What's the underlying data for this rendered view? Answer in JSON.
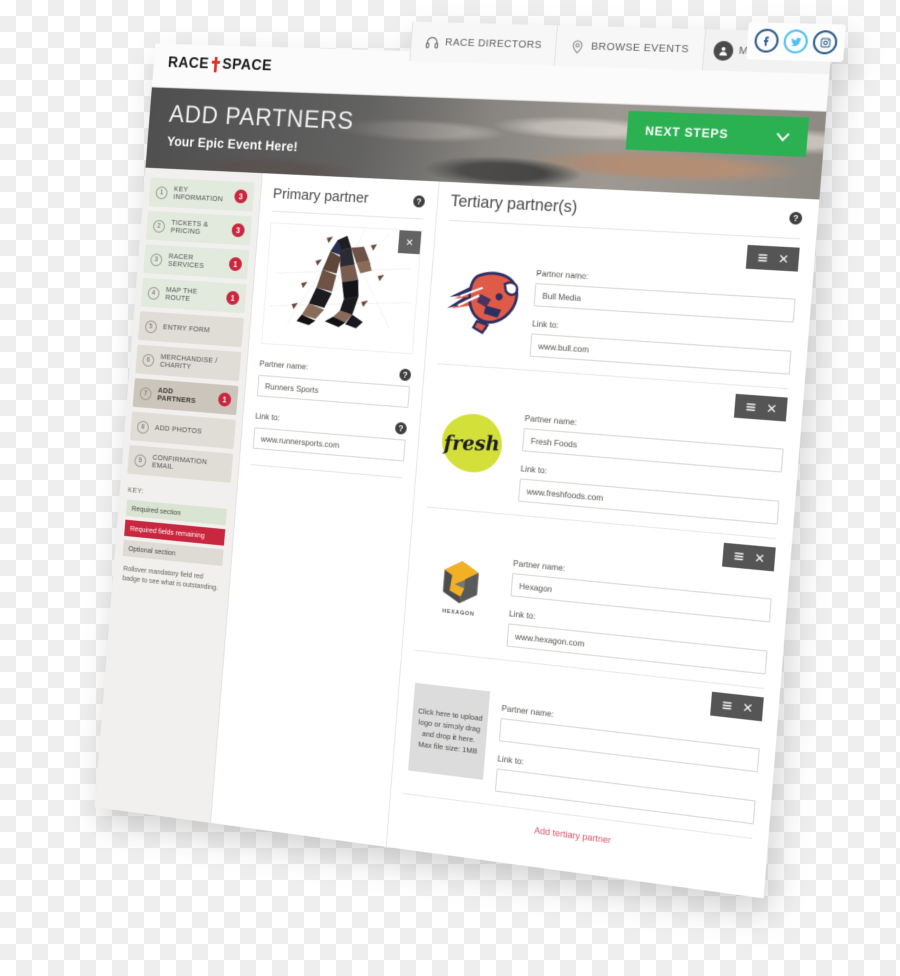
{
  "brand": {
    "name_left": "RACE",
    "name_right": "SPACE",
    "mark": "cross-icon"
  },
  "topnav": {
    "items": [
      {
        "label": "RACE DIRECTORS",
        "icon": "headset-icon"
      },
      {
        "label": "BROWSE EVENTS",
        "icon": "map-pin-icon"
      },
      {
        "label": "MY ACCOUNT",
        "icon": "user-avatar-icon"
      }
    ],
    "social": [
      {
        "name": "facebook-icon",
        "color": "#2a5a8c"
      },
      {
        "name": "twitter-icon",
        "color": "#4fc0f0"
      },
      {
        "name": "instagram-icon",
        "color": "#2a5a8c"
      }
    ]
  },
  "hero": {
    "title": "ADD PARTNERS",
    "subtitle": "Your Epic Event Here!",
    "next_steps_label": "NEXT STEPS",
    "next_steps_color": "#2cb152"
  },
  "sidebar": {
    "items": [
      {
        "num": "1",
        "label": "KEY INFORMATION",
        "badge": "3",
        "state": "req"
      },
      {
        "num": "2",
        "label": "TICKETS & PRICING",
        "badge": "3",
        "state": "req"
      },
      {
        "num": "3",
        "label": "RACER SERVICES",
        "badge": "1",
        "state": "req"
      },
      {
        "num": "4",
        "label": "MAP THE ROUTE",
        "badge": "1",
        "state": "req"
      },
      {
        "num": "5",
        "label": "ENTRY FORM",
        "badge": "",
        "state": "opt"
      },
      {
        "num": "6",
        "label": "MERCHANDISE / CHARITY",
        "badge": "",
        "state": "opt"
      },
      {
        "num": "7",
        "label": "ADD PARTNERS",
        "badge": "1",
        "state": "active"
      },
      {
        "num": "8",
        "label": "ADD PHOTOS",
        "badge": "",
        "state": "opt"
      },
      {
        "num": "9",
        "label": "CONFIRMATION EMAIL",
        "badge": "",
        "state": "opt"
      }
    ],
    "key": {
      "title": "KEY:",
      "required": "Required section",
      "remaining": "Required fields remaining",
      "optional": "Optional section",
      "note": "Rollover mandatory field red badge to see what is outstanding."
    },
    "colors": {
      "required_section": "#d9e4d2",
      "fields_remaining": "#c8273f",
      "optional_section": "#dedad4",
      "active_item": "#ccc5bb"
    }
  },
  "primary": {
    "title": "Primary partner",
    "help": "?",
    "logo_alt": "runner-polygon-artwork",
    "remove_icon": "close-icon",
    "name_label": "Partner name:",
    "name_value": "Runners Sports",
    "link_label": "Link to:",
    "link_value": "www.runnersports.com"
  },
  "tertiary": {
    "title": "Tertiary partner(s)",
    "help": "?",
    "name_label": "Partner name:",
    "link_label": "Link to:",
    "add_link": "Add tertiary partner",
    "add_link_color": "#d8556a",
    "upload_text": "Click here to upload logo or simply drag and drop it here. Max file size: 1MB",
    "rows": [
      {
        "logo": "bull-media-logo",
        "name": "Bull Media",
        "link": "www.bull.com"
      },
      {
        "logo": "fresh-foods-logo",
        "name": "Fresh Foods",
        "link": "www.freshfoods.com"
      },
      {
        "logo": "hexagon-logo",
        "name": "Hexagon",
        "link": "www.hexagon.com"
      },
      {
        "logo": "upload-placeholder",
        "name": "",
        "link": ""
      }
    ]
  }
}
